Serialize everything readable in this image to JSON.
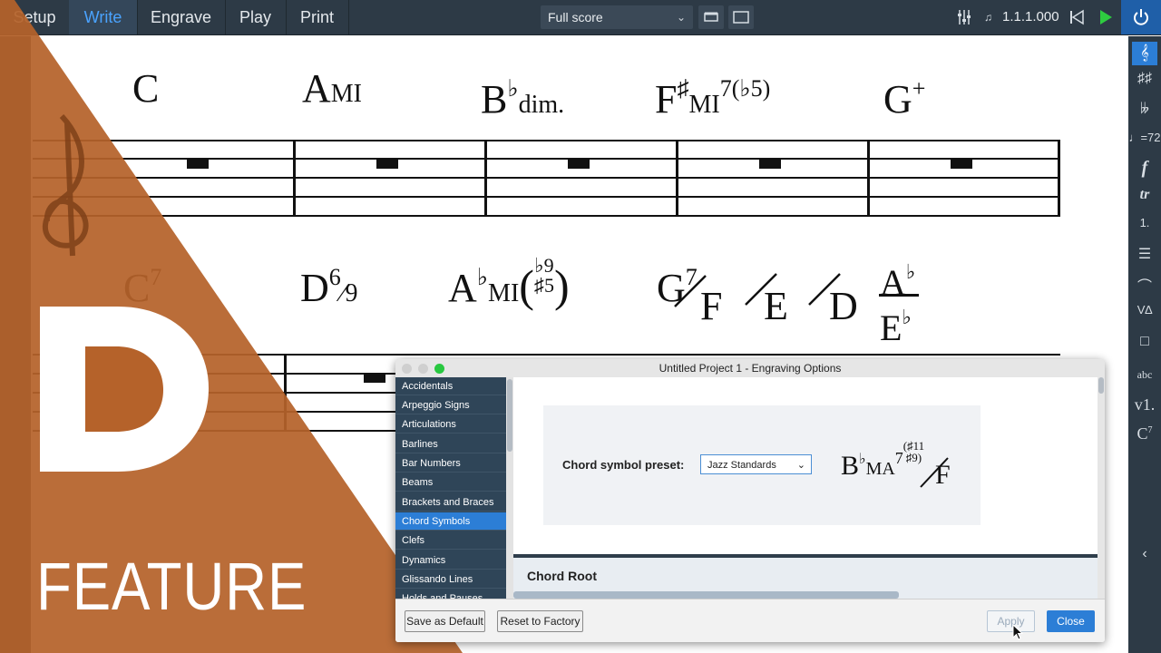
{
  "toolbar": {
    "modes": [
      {
        "label": "Setup",
        "active": false
      },
      {
        "label": "Write",
        "active": true
      },
      {
        "label": "Engrave",
        "active": false
      },
      {
        "label": "Play",
        "active": false
      },
      {
        "label": "Print",
        "active": false
      }
    ],
    "layout_select": "Full score",
    "position": "1.1.1.000",
    "accent": "#4aa3ff"
  },
  "score": {
    "row1_chords": [
      "C",
      "A",
      "B",
      "F",
      "G"
    ],
    "row1_suffixes": [
      "",
      "MI",
      "dim.",
      "MI",
      "+"
    ],
    "row2_chords": [
      "C",
      "D",
      "A",
      "G",
      "F",
      "E",
      "D",
      "A",
      "E"
    ]
  },
  "overlay": {
    "feature_label": "FEATURE",
    "brand_color": "#b5622a"
  },
  "dialog": {
    "title": "Untitled Project 1 - Engraving Options",
    "nav_items": [
      "Accidentals",
      "Arpeggio Signs",
      "Articulations",
      "Barlines",
      "Bar Numbers",
      "Beams",
      "Brackets and Braces",
      "Chord Symbols",
      "Clefs",
      "Dynamics",
      "Glissando Lines",
      "Holds and Pauses"
    ],
    "selected_nav": "Chord Symbols",
    "preset_label": "Chord symbol preset:",
    "preset_value": "Jazz Standards",
    "section_title": "Chord Root",
    "buttons": {
      "save_default": "Save as Default",
      "reset_factory": "Reset to Factory",
      "apply": "Apply",
      "close": "Close"
    }
  }
}
